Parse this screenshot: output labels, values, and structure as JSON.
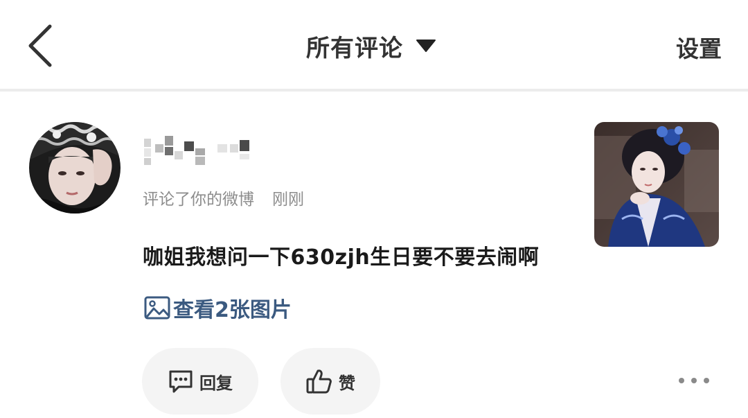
{
  "header": {
    "back_icon": "chevron-left-icon",
    "title": "所有评论",
    "caret_icon": "triangle-down-icon",
    "settings_label": "设置"
  },
  "comment": {
    "avatar_icon": "user-avatar",
    "username_hidden": true,
    "action_text": "评论了你的微博",
    "time_text": "刚刚",
    "text": "咖姐我想问一下630zjh生日要不要去闹啊",
    "view_images_label": "查看2张图片",
    "image_icon": "image-icon",
    "thumbnail_icon": "post-thumbnail"
  },
  "actions": {
    "reply_label": "回复",
    "reply_icon": "comment-icon",
    "like_label": "赞",
    "like_icon": "thumbs-up-icon",
    "more_icon": "more-dots-icon"
  },
  "colors": {
    "link": "#3b5a80",
    "meta": "#8c8c8c",
    "pill_bg": "#f4f4f4"
  }
}
